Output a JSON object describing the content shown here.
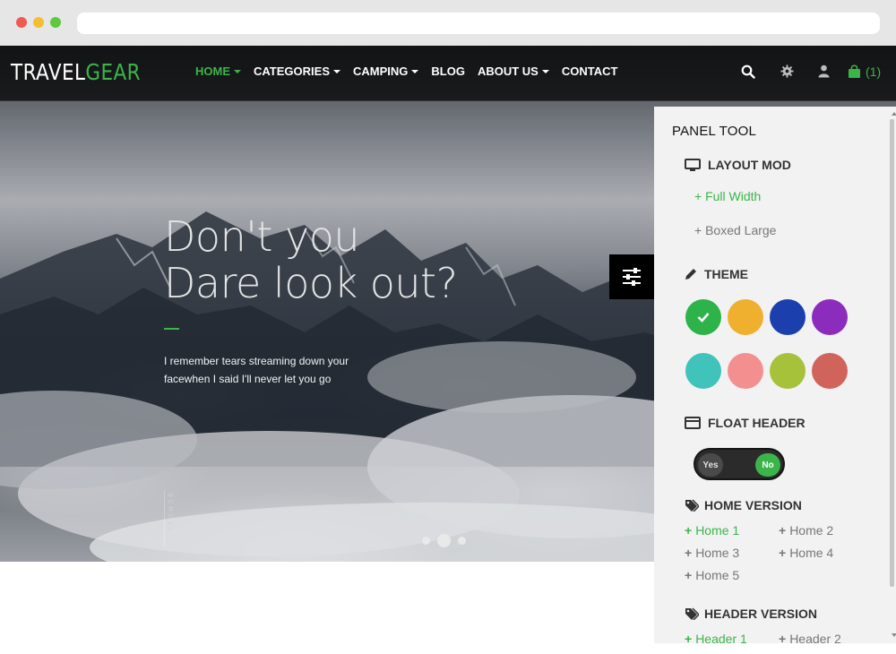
{
  "header": {
    "logo_part1": "TRAVEL",
    "logo_part2": "GEAR",
    "nav": [
      {
        "label": "HOME",
        "has_caret": true,
        "active": true
      },
      {
        "label": "CATEGORIES",
        "has_caret": true,
        "active": false
      },
      {
        "label": "CAMPING",
        "has_caret": true,
        "active": false
      },
      {
        "label": "BLOG",
        "has_caret": false,
        "active": false
      },
      {
        "label": "ABOUT US",
        "has_caret": true,
        "active": false
      },
      {
        "label": "CONTACT",
        "has_caret": false,
        "active": false
      }
    ],
    "icons": [
      "search-icon",
      "gear-icon",
      "user-icon",
      "shopping-bag-icon"
    ],
    "cart_count": "(1)"
  },
  "hero": {
    "headline_line1": "Don't you",
    "headline_line2": "Dare look out?",
    "subtext_line1": "I remember tears streaming down your",
    "subtext_line2": "facewhen I said I'll never let you go",
    "scroll_label": "SCROLL",
    "slides": 3,
    "active_slide": 2
  },
  "panel": {
    "title": "PANEL TOOL",
    "layout_title": "LAYOUT MOD",
    "layout_options": [
      {
        "label": "+ Full Width",
        "active": true
      },
      {
        "label": "+ Boxed Large",
        "active": false
      }
    ],
    "theme_title": "THEME",
    "theme_colors": [
      "#2db34a",
      "#eeb02e",
      "#1c3fae",
      "#8c2cbd",
      "#3fc3bb",
      "#f38f8f",
      "#a6c13a",
      "#d1645a"
    ],
    "theme_selected": 0,
    "float_header_title": "FLOAT HEADER",
    "float_toggle": {
      "yes_label": "Yes",
      "no_label": "No",
      "value": "No"
    },
    "home_version_title": "HOME VERSION",
    "home_versions": [
      {
        "label": "Home 1",
        "active": true
      },
      {
        "label": "Home 2",
        "active": false
      },
      {
        "label": "Home 3",
        "active": false
      },
      {
        "label": "Home 4",
        "active": false
      },
      {
        "label": "Home 5",
        "active": false
      }
    ],
    "header_version_title": "HEADER VERSION",
    "header_versions": [
      {
        "label": "Header 1",
        "active": true
      },
      {
        "label": "Header 2",
        "active": false
      }
    ]
  },
  "colors": {
    "accent": "#3bb54a",
    "header_bg": "#0a0a0a",
    "panel_bg": "#f2f2f2"
  }
}
